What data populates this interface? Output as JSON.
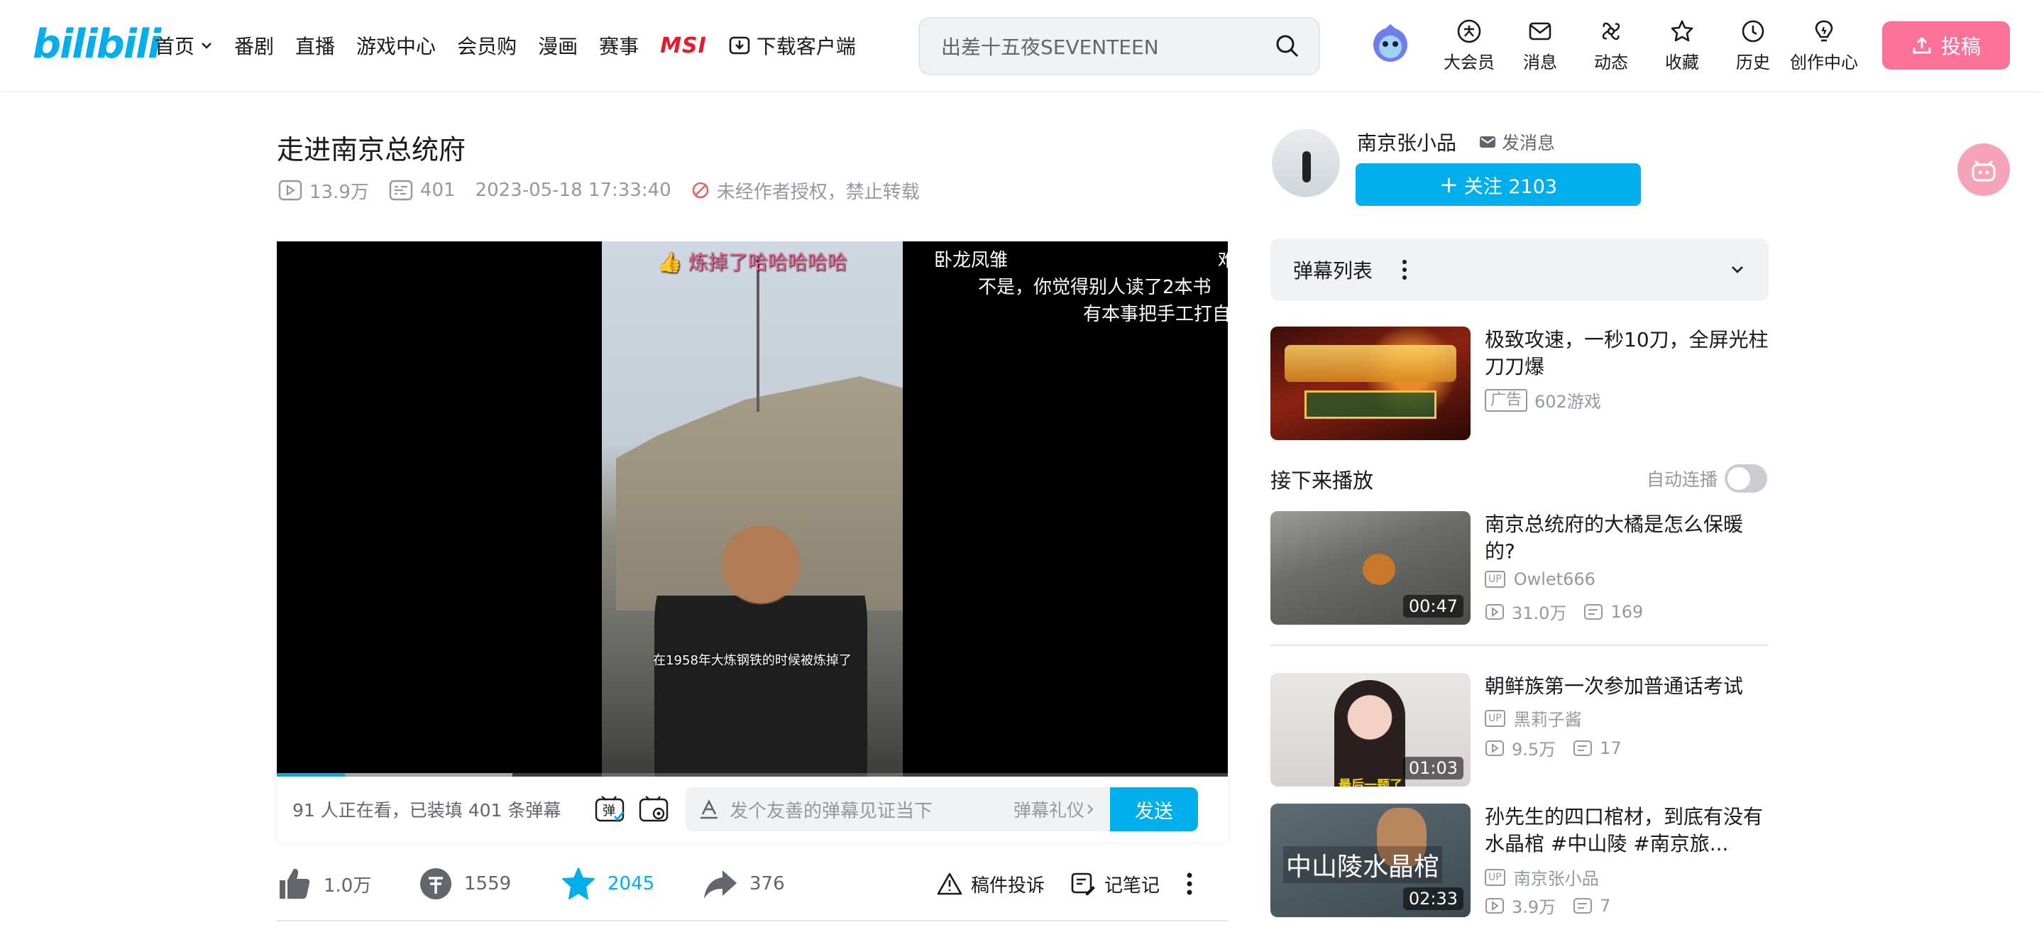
{
  "header": {
    "logo": "bilibili",
    "nav": [
      {
        "label": "首页"
      },
      {
        "label": "番剧"
      },
      {
        "label": "直播"
      },
      {
        "label": "游戏中心"
      },
      {
        "label": "会员购"
      },
      {
        "label": "漫画"
      },
      {
        "label": "赛事"
      }
    ],
    "msi_label": "MSI",
    "download_label": "下载客户端",
    "search_placeholder": "出差十五夜SEVENTEEN",
    "right_nav": [
      {
        "label": "大会员",
        "icon": "vip-icon"
      },
      {
        "label": "消息",
        "icon": "message-icon"
      },
      {
        "label": "动态",
        "icon": "dynamic-icon"
      },
      {
        "label": "收藏",
        "icon": "star-icon"
      },
      {
        "label": "历史",
        "icon": "clock-icon"
      },
      {
        "label": "创作中心",
        "icon": "bulb-icon"
      }
    ],
    "upload_label": "投稿"
  },
  "video": {
    "title": "走进南京总统府",
    "views": "13.9万",
    "danmaku_count": "401",
    "date": "2023-05-18 17:33:40",
    "copyright": "未经作者授权，禁止转载"
  },
  "player": {
    "danmaku_top": "炼掉了哈哈哈哈哈",
    "danmaku_lines": [
      "卧龙凤雏",
      "不是，你觉得别人读了2本书",
      "有本事把手工打自"
    ],
    "danmaku_right_char": "难",
    "subtitle": "在1958年大炼钢铁的时候被炼掉了",
    "progress": 0.072,
    "buffered": 0.248
  },
  "danmaku_bar": {
    "info": "91 人正在看，已装填 401 条弹幕",
    "input_placeholder": "发个友善的弹幕见证当下",
    "etiquette": "弹幕礼仪",
    "send": "发送",
    "toggle_icon_text": "弹"
  },
  "toolbar": {
    "like": "1.0万",
    "coin": "1559",
    "favorite": "2045",
    "share": "376",
    "report": "稿件投诉",
    "notes": "记笔记"
  },
  "uploader": {
    "name": "南京张小品",
    "message": "发消息",
    "follow": "关注 2103"
  },
  "danmaku_list": {
    "title": "弹幕列表"
  },
  "ad_card": {
    "title": "极致攻速，一秒10刀，全屏光柱刀刀爆",
    "badge": "广告",
    "source": "602游戏"
  },
  "next_section": {
    "title": "接下来播放",
    "autoplay": "自动连播"
  },
  "recommendations": [
    {
      "title": "南京总统府的大橘是怎么保暖的?",
      "up": "Owlet666",
      "views": "31.0万",
      "danmaku": "169",
      "duration": "00:47"
    },
    {
      "title": "朝鲜族第一次参加普通话考试",
      "up": "黑莉子酱",
      "views": "9.5万",
      "danmaku": "17",
      "duration": "01:03",
      "thumb_text": "最后一题了"
    },
    {
      "title": "孙先生的四口棺材，到底有没有水晶棺 #中山陵 #南京旅...",
      "up": "南京张小品",
      "views": "3.9万",
      "danmaku": "7",
      "duration": "02:33",
      "thumb_text": "中山陵水晶棺"
    }
  ],
  "colors": {
    "brand_blue": "#00aeec",
    "brand_pink": "#fb7299",
    "text_gray": "#9499a0"
  }
}
